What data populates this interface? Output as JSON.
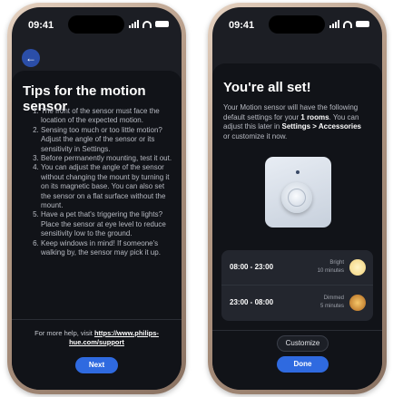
{
  "status": {
    "time": "09:41"
  },
  "tips_screen": {
    "title": "Tips for the motion sensor",
    "tips": [
      "The front of the sensor must face the location of the expected motion.",
      "Sensing too much or too little motion? Adjust the angle of the sensor or its sensitivity in Settings.",
      "Before permanently mounting, test it out.",
      "You can adjust the angle of the sensor without changing the mount by turning it on its magnetic base. You can also set the sensor on a flat surface without the mount.",
      "Have a pet that's triggering the lights? Place the sensor at eye level to reduce sensitivity low to the ground.",
      "Keep windows in mind! If someone's walking by, the sensor may pick it up."
    ],
    "help_prefix": "For more help, visit ",
    "help_link": "https://www.philips-hue.com/support",
    "next_label": "Next"
  },
  "done_screen": {
    "title": "You're all set!",
    "intro_1": "Your Motion sensor will have the following default settings for your ",
    "intro_bold_1": "1 rooms",
    "intro_2": ". You can adjust this later in ",
    "intro_bold_2": "Settings > Accessories",
    "intro_3": " or customize it now.",
    "schedule": [
      {
        "range": "08:00 - 23:00",
        "scene": "Bright",
        "duration": "10 minutes",
        "color": "#f2d27a"
      },
      {
        "range": "23:00 - 08:00",
        "scene": "Dimmed",
        "duration": "5 minutes",
        "color": "#c9822a"
      }
    ],
    "customize_label": "Customize",
    "done_label": "Done"
  },
  "colors": {
    "accent": "#2f6ae0",
    "background": "#111318"
  }
}
